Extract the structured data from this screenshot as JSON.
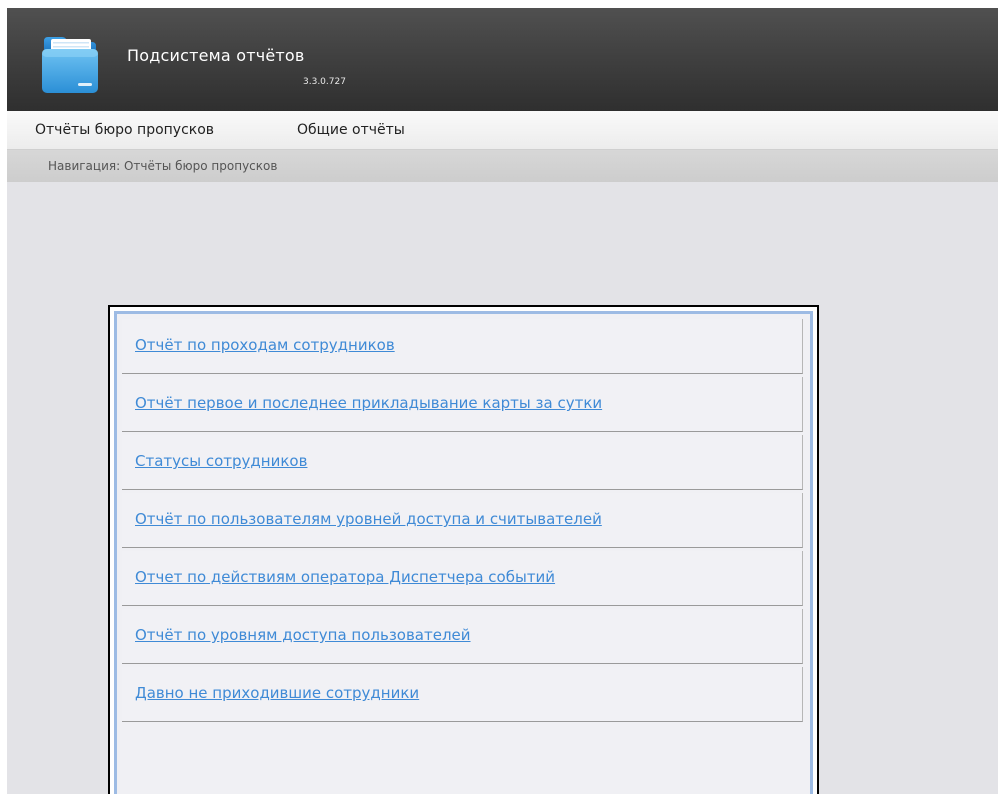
{
  "app": {
    "title": "Подсистема отчётов",
    "version": "3.3.0.727"
  },
  "menu": {
    "items": [
      {
        "label": "Отчёты бюро пропусков"
      },
      {
        "label": "Общие отчёты"
      }
    ]
  },
  "breadcrumb": {
    "text": "Навигация: Отчёты бюро пропусков"
  },
  "reports": [
    {
      "label": "Отчёт по проходам сотрудников"
    },
    {
      "label": "Отчёт первое и последнее прикладывание карты за сутки"
    },
    {
      "label": "Статусы сотрудников"
    },
    {
      "label": "Отчёт по пользователям уровней доступа и считывателей"
    },
    {
      "label": "Отчет по действиям оператора Диспетчера событий"
    },
    {
      "label": "Отчёт по уровням доступа пользователей"
    },
    {
      "label": "Давно не приходившие сотрудники"
    }
  ],
  "colors": {
    "link": "#3f8ad6",
    "header": "#3c3c3c",
    "panel_border": "#9dbbe4"
  },
  "icons": {
    "logo": "folder-icon"
  }
}
